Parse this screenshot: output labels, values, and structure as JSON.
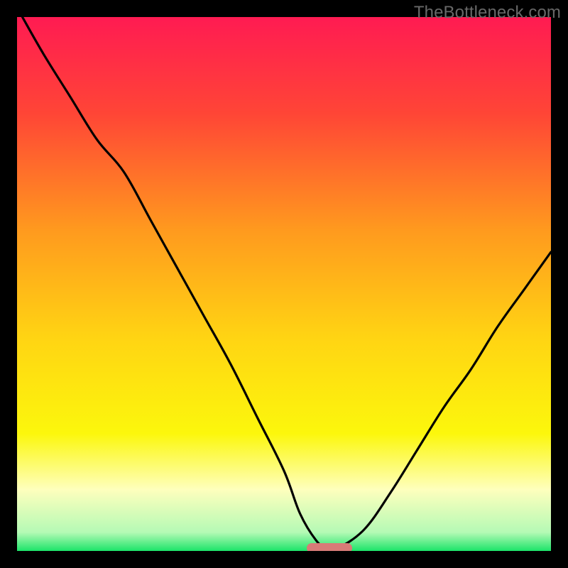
{
  "watermark": "TheBottleneck.com",
  "chart_data": {
    "type": "line",
    "title": "",
    "xlabel": "",
    "ylabel": "",
    "xlim": [
      0,
      100
    ],
    "ylim": [
      0,
      100
    ],
    "grid": false,
    "legend": false,
    "background_gradient_stops": [
      {
        "offset": 0,
        "color": "#ff1b52"
      },
      {
        "offset": 0.18,
        "color": "#ff4536"
      },
      {
        "offset": 0.4,
        "color": "#ff9a1e"
      },
      {
        "offset": 0.6,
        "color": "#ffd413"
      },
      {
        "offset": 0.78,
        "color": "#fcf70c"
      },
      {
        "offset": 0.885,
        "color": "#feffbd"
      },
      {
        "offset": 0.965,
        "color": "#b5fab5"
      },
      {
        "offset": 1.0,
        "color": "#1ce469"
      }
    ],
    "series": [
      {
        "name": "bottleneck-curve",
        "color": "#000000",
        "x": [
          1,
          5,
          10,
          15,
          20,
          25,
          30,
          35,
          40,
          45,
          50,
          53,
          56,
          58,
          60,
          65,
          70,
          75,
          80,
          85,
          90,
          95,
          100
        ],
        "y": [
          100,
          93,
          85,
          77,
          71,
          62,
          53,
          44,
          35,
          25,
          15,
          7,
          2,
          0.5,
          0.5,
          4,
          11,
          19,
          27,
          34,
          42,
          49,
          56
        ]
      }
    ],
    "marker": {
      "x_center": 58.5,
      "y": 0,
      "width_pct": 8.5,
      "color": "#d87b77"
    }
  }
}
